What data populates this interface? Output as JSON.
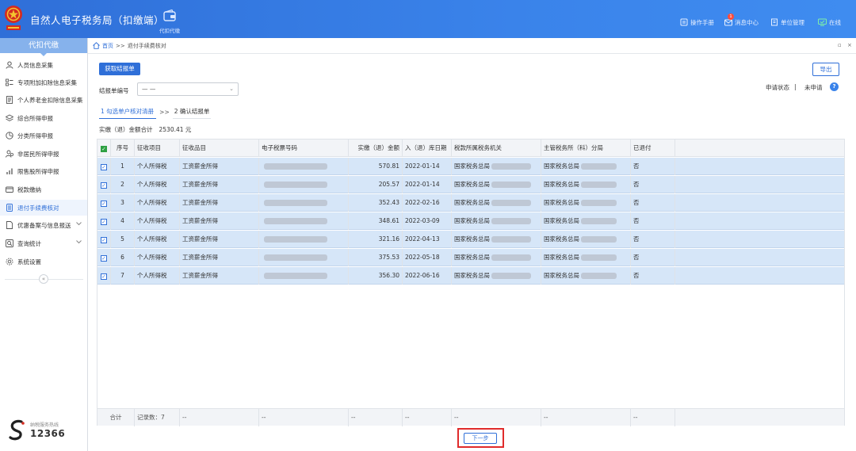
{
  "header": {
    "title": "自然人电子税务局（扣缴端）",
    "tool_label": "代扣代缴",
    "links": [
      {
        "name": "manual",
        "label": "操作手册",
        "icon": "book-icon"
      },
      {
        "name": "messages",
        "label": "消息中心",
        "icon": "mail-icon",
        "badge": "1"
      },
      {
        "name": "unit",
        "label": "单位管理",
        "icon": "building-icon"
      },
      {
        "name": "online",
        "label": "在线",
        "icon": "monitor-icon"
      }
    ]
  },
  "sidebar": {
    "title": "代扣代缴",
    "items": [
      {
        "label": "人员信息采集",
        "icon": "person-icon"
      },
      {
        "label": "专项附加扣除信息采集",
        "icon": "list-icon"
      },
      {
        "label": "个人养老金扣除信息采集",
        "icon": "doc-icon"
      },
      {
        "label": "综合所得申报",
        "icon": "layers-icon"
      },
      {
        "label": "分类所得申报",
        "icon": "pie-icon"
      },
      {
        "label": "非居民所得申报",
        "icon": "person-globe-icon"
      },
      {
        "label": "限售股所得申报",
        "icon": "chart-icon"
      },
      {
        "label": "税款缴纳",
        "icon": "card-icon"
      },
      {
        "label": "退付手续费核对",
        "icon": "ledger-icon"
      },
      {
        "label": "优惠备案与信息报送",
        "icon": "file-icon"
      },
      {
        "label": "查询统计",
        "icon": "search-icon"
      },
      {
        "label": "系统设置",
        "icon": "gear-icon"
      }
    ],
    "collapse_label": "«",
    "hotline_label": "纳税服务热线",
    "hotline_number": "12366"
  },
  "breadcrumb": {
    "home": "首页",
    "separator": ">>",
    "current": "退付手续费核对"
  },
  "toolbar": {
    "fetch_label": "获取结报单",
    "export_label": "导出",
    "form_label": "结报单编号",
    "select_value": "— —",
    "status_label": "申请状态",
    "status_sep": "|",
    "status_value": "未申请",
    "help": "?"
  },
  "steps": {
    "step1": "1 勾选单户核对清册",
    "sep": ">>",
    "step2": "2 确认结报单"
  },
  "summary": {
    "label": "实缴（退）金额合计",
    "amount": "2530.41 元"
  },
  "table": {
    "columns": [
      "序号",
      "征收项目",
      "征收品目",
      "电子税票号码",
      "实缴（退）金额",
      "入（退）库日期",
      "税款所属税务机关",
      "主管税务所（科）分局",
      "已退付"
    ],
    "rows": [
      {
        "no": "1",
        "item": "个人所得税",
        "sub": "工资薪金所得",
        "amount": "570.81",
        "date": "2022-01-14",
        "authority": "国家税务总局",
        "bureau": "国家税务总局",
        "refunded": "否"
      },
      {
        "no": "2",
        "item": "个人所得税",
        "sub": "工资薪金所得",
        "amount": "205.57",
        "date": "2022-01-14",
        "authority": "国家税务总局",
        "bureau": "国家税务总局",
        "refunded": "否"
      },
      {
        "no": "3",
        "item": "个人所得税",
        "sub": "工资薪金所得",
        "amount": "352.43",
        "date": "2022-02-16",
        "authority": "国家税务总局",
        "bureau": "国家税务总局",
        "refunded": "否"
      },
      {
        "no": "4",
        "item": "个人所得税",
        "sub": "工资薪金所得",
        "amount": "348.61",
        "date": "2022-03-09",
        "authority": "国家税务总局",
        "bureau": "国家税务总局",
        "refunded": "否"
      },
      {
        "no": "5",
        "item": "个人所得税",
        "sub": "工资薪金所得",
        "amount": "321.16",
        "date": "2022-04-13",
        "authority": "国家税务总局",
        "bureau": "国家税务总局",
        "refunded": "否"
      },
      {
        "no": "6",
        "item": "个人所得税",
        "sub": "工资薪金所得",
        "amount": "375.53",
        "date": "2022-05-18",
        "authority": "国家税务总局",
        "bureau": "国家税务总局",
        "refunded": "否"
      },
      {
        "no": "7",
        "item": "个人所得税",
        "sub": "工资薪金所得",
        "amount": "356.30",
        "date": "2022-06-16",
        "authority": "国家税务总局",
        "bureau": "国家税务总局",
        "refunded": "否"
      }
    ],
    "footer": {
      "label": "合计",
      "count": "记录数：7",
      "dash": "--"
    }
  },
  "next_label": "下一步",
  "colors": {
    "primary": "#2f6fd8",
    "header_bg": "#3a83ea",
    "row_selected": "#d6e6f8",
    "highlight_box": "#e02b2b"
  }
}
